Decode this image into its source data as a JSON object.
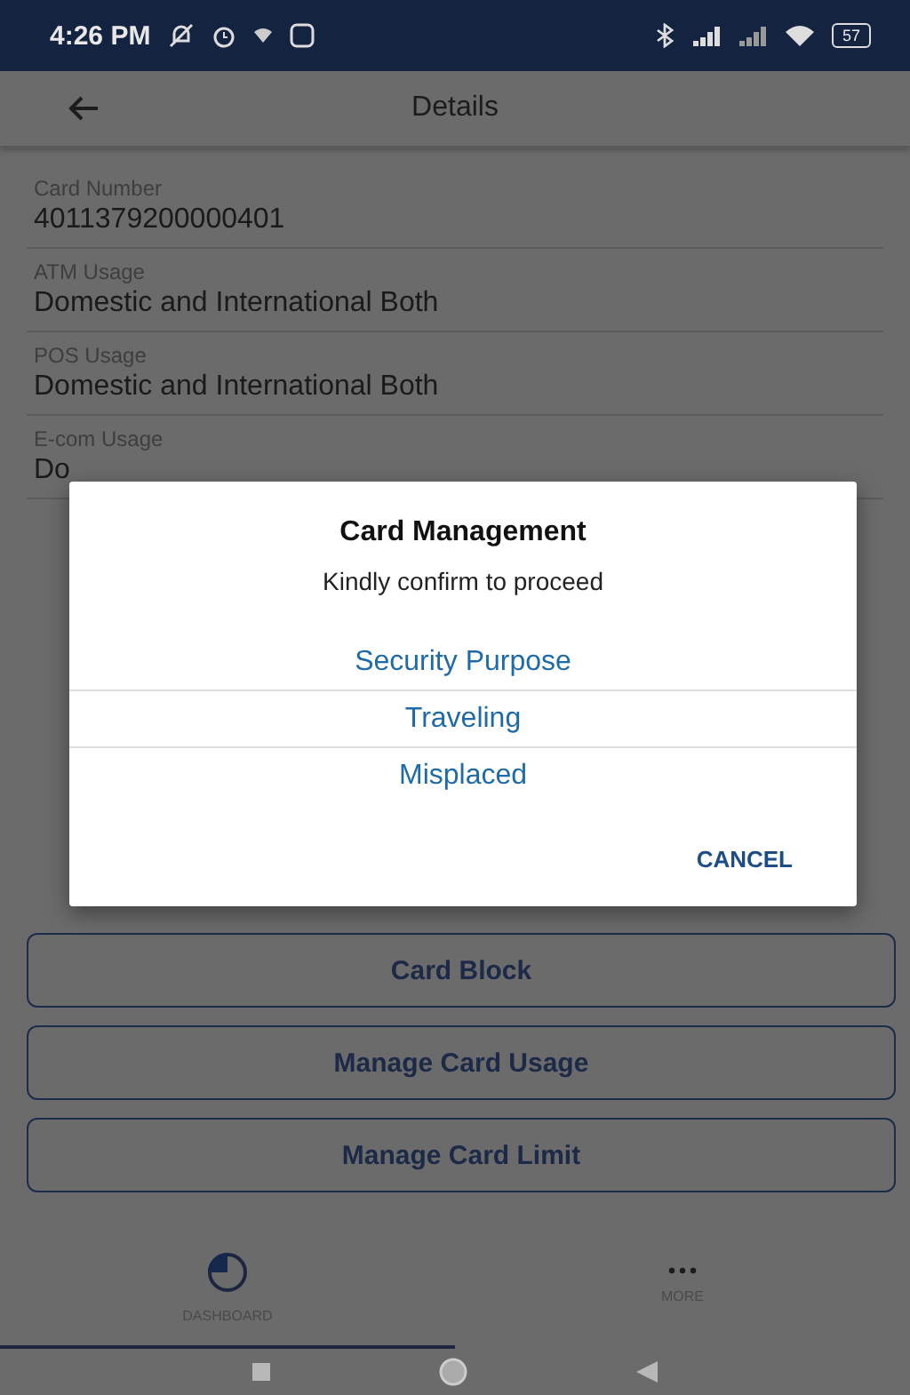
{
  "status_bar": {
    "time": "4:26 PM",
    "battery": "57"
  },
  "app_bar": {
    "title": "Details"
  },
  "fields": [
    {
      "label": "Card Number",
      "value": "4011379200000401"
    },
    {
      "label": "ATM Usage",
      "value": "Domestic and International Both"
    },
    {
      "label": "POS Usage",
      "value": "Domestic and International Both"
    },
    {
      "label": "E-com Usage",
      "value": "Do"
    }
  ],
  "dialog": {
    "title": "Card Management",
    "message": "Kindly confirm to proceed",
    "options": [
      "Security Purpose",
      "Traveling",
      "Misplaced"
    ],
    "cancel": "CANCEL"
  },
  "buttons": [
    "Card Block",
    "Manage Card Usage",
    "Manage Card Limit"
  ],
  "bottom_nav": [
    {
      "label": "DASHBOARD",
      "kind": "dashboard",
      "selected": true
    },
    {
      "label": "MORE",
      "kind": "more",
      "selected": false
    }
  ]
}
